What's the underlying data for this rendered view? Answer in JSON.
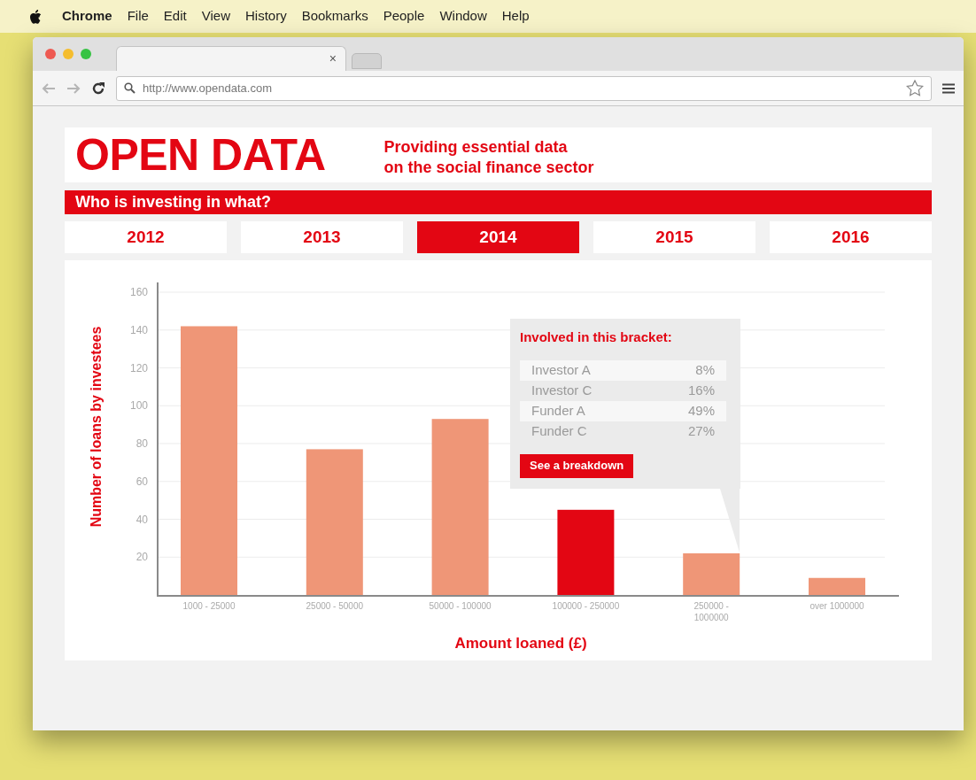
{
  "menu_bar": {
    "app": "Chrome",
    "items": [
      "File",
      "Edit",
      "View",
      "History",
      "Bookmarks",
      "People",
      "Window",
      "Help"
    ]
  },
  "browser": {
    "tab_close": "×",
    "address": "http://www.opendata.com"
  },
  "header": {
    "logo": "OPEN DATA",
    "tagline_lines": [
      "Providing essential data",
      "on the social finance sector"
    ]
  },
  "section_title": "Who is investing in what?",
  "year_tabs": [
    {
      "label": "2012",
      "selected": false
    },
    {
      "label": "2013",
      "selected": false
    },
    {
      "label": "2014",
      "selected": true
    },
    {
      "label": "2015",
      "selected": false
    },
    {
      "label": "2016",
      "selected": false
    }
  ],
  "chart": {
    "chart_data": {
      "type": "bar",
      "xlabel": "Amount loaned (£)",
      "ylabel": "Number of loans by investees",
      "categories": [
        "1000 - 25000",
        "25000 - 50000",
        "50000 - 100000",
        "100000 - 250000",
        "250000 - 1000000",
        "over 1000000"
      ],
      "series": [
        {
          "color": "#ef9677",
          "values": [
            142,
            77,
            93,
            null,
            22,
            9
          ]
        },
        {
          "color": "#e30613",
          "values": [
            null,
            null,
            null,
            45,
            null,
            null
          ]
        }
      ],
      "stacked": true,
      "grid": true,
      "ylim": [
        0,
        160
      ],
      "yticks": [
        20,
        40,
        60,
        80,
        100,
        120,
        140,
        160
      ]
    },
    "tooltip": {
      "title": "Involved in this bracket:",
      "rows": [
        {
          "name": "Investor A",
          "share": "8%"
        },
        {
          "name": "Investor C",
          "share": "16%"
        },
        {
          "name": "Funder A",
          "share": "49%"
        },
        {
          "name": "Funder C",
          "share": "27%"
        }
      ],
      "button": "See a breakdown"
    }
  }
}
